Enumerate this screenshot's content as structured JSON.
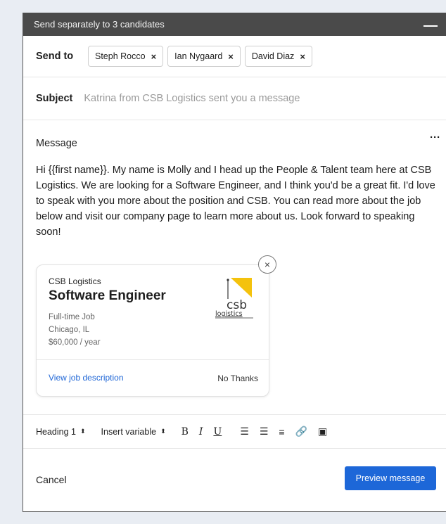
{
  "titlebar": {
    "title": "Send separately to 3 candidates"
  },
  "sendto": {
    "label": "Send to",
    "recipients": [
      {
        "name": "Steph Rocco"
      },
      {
        "name": "Ian Nygaard"
      },
      {
        "name": "David Diaz"
      }
    ],
    "remove_glyph": "×"
  },
  "subject": {
    "label": "Subject",
    "placeholder": "Katrina from CSB Logistics sent you a message"
  },
  "message": {
    "label": "Message",
    "more_glyph": "···",
    "body": "Hi {{first name}}. My name is Molly and I head up the People & Talent team here at CSB Logistics. We are looking for a Software Engineer, and I think you'd be a great fit. I'd love to speak with you more about the position and CSB. You can read more about the job below and visit our company page to learn more about us. Look forward to speaking soon!"
  },
  "job_card": {
    "company": "CSB Logistics",
    "title": "Software Engineer",
    "type": "Full-time Job",
    "location": "Chicago, IL",
    "salary": "$60,000 / year",
    "view_link": "View job description",
    "decline": "No Thanks",
    "close_glyph": "×",
    "logo_line1": "csb",
    "logo_line2": "logistics",
    "logo_accent": "#f4c20d"
  },
  "toolbar": {
    "heading": "Heading 1",
    "insert_variable": "Insert variable",
    "select_arrow": "⬍",
    "bold": "B",
    "italic": "I",
    "underline": "U",
    "ordered_list": "☰",
    "bullet_list": "☰",
    "align": "≡",
    "link": "🔗",
    "image": "▣"
  },
  "footer": {
    "cancel": "Cancel",
    "preview": "Preview message"
  },
  "colors": {
    "titlebar": "#4a4a4a",
    "primary": "#1d67d8",
    "link": "#1f66d6"
  }
}
